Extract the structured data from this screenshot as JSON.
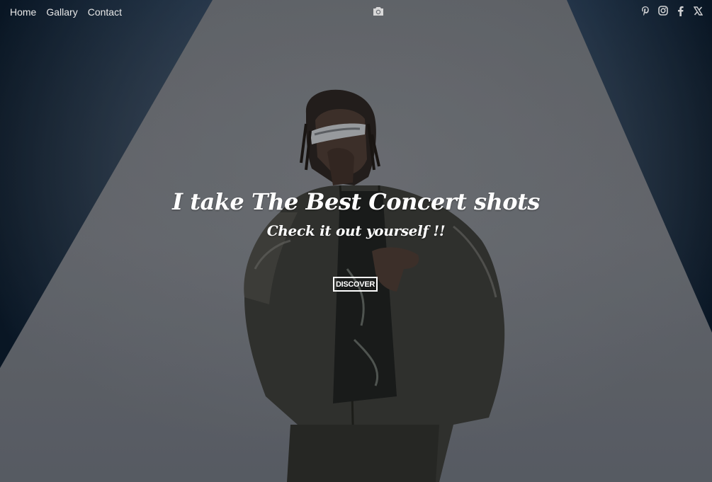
{
  "nav": {
    "items": [
      {
        "label": "Home"
      },
      {
        "label": "Gallary"
      },
      {
        "label": "Contact"
      }
    ]
  },
  "logo": {
    "icon": "camera-icon"
  },
  "social": {
    "icons": [
      "pinterest-icon",
      "instagram-icon",
      "facebook-icon",
      "x-icon"
    ]
  },
  "hero": {
    "headline": "I take The Best Concert shots",
    "subline": "Check it out yourself !!",
    "cta_label": "DISCOVER"
  },
  "colors": {
    "text": "#ffffff",
    "nav_text": "#e8e8e8",
    "spotlight": "#7d8088",
    "background_dark": "#0f1a26"
  }
}
